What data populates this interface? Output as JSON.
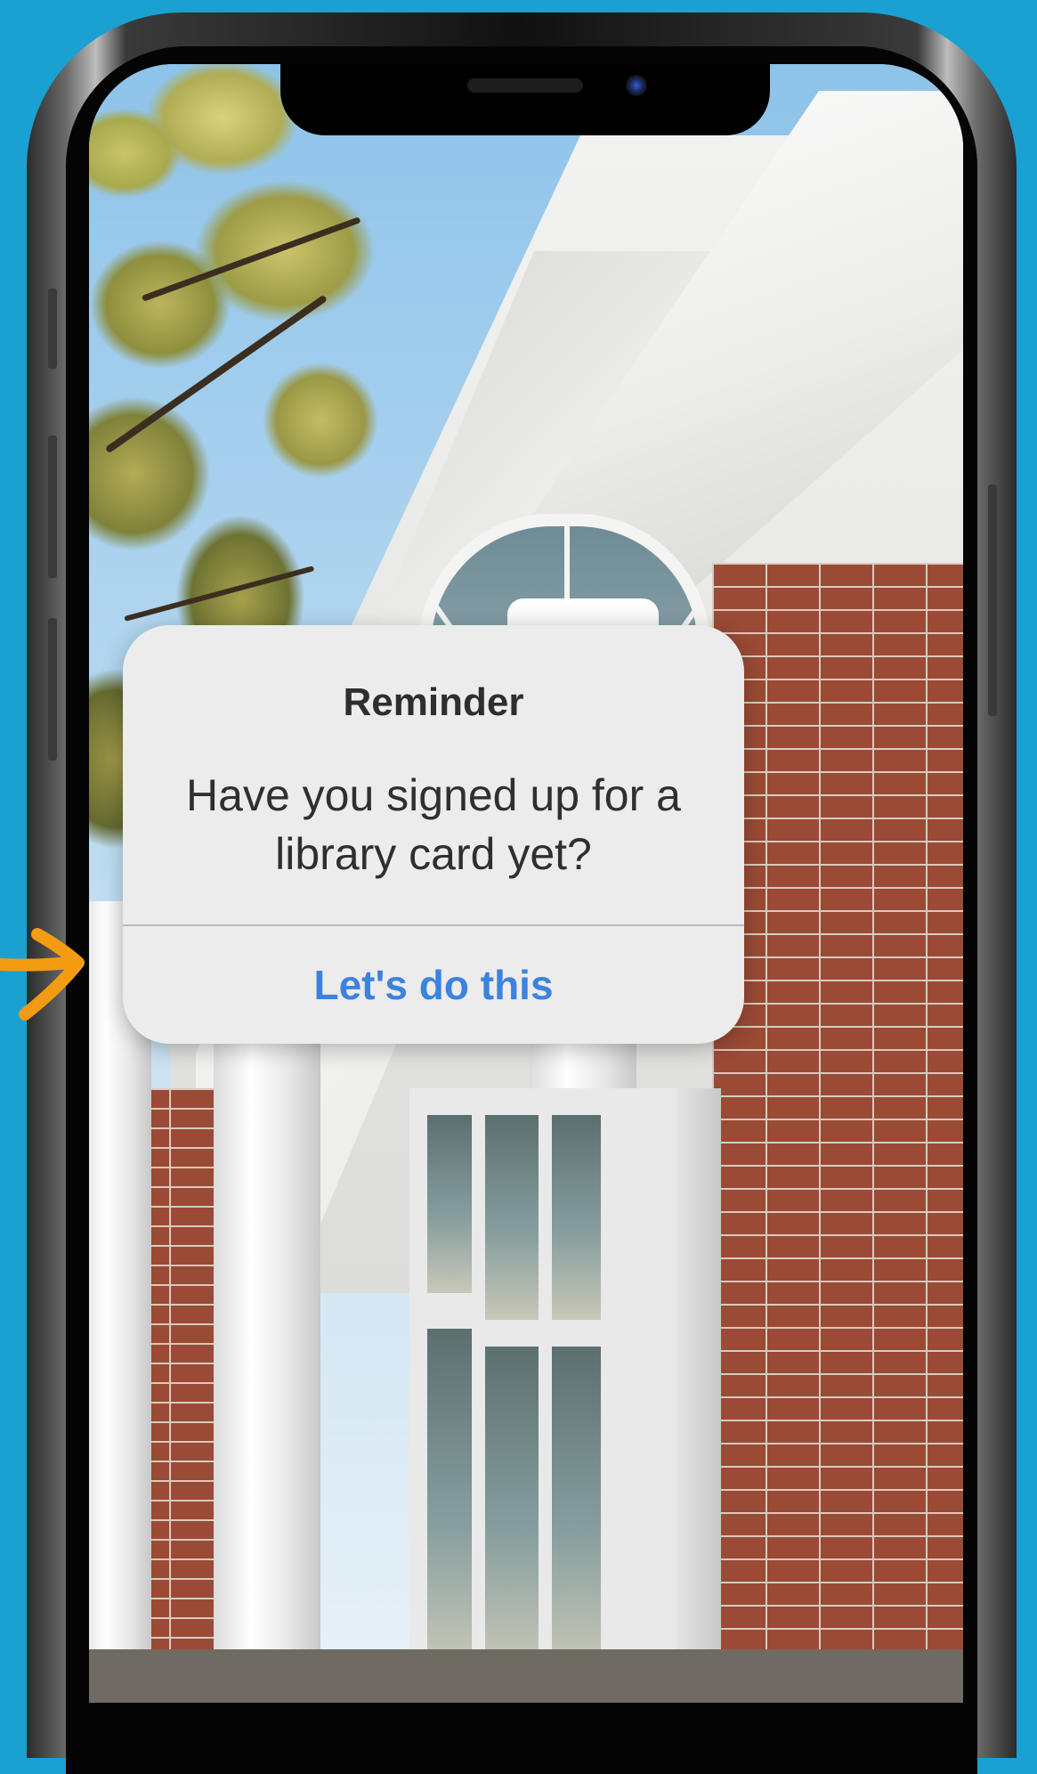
{
  "colors": {
    "background": "#1aa1d2",
    "alert_bg": "#ececec",
    "action_blue": "#3b83df",
    "arrow_orange": "#f39c12"
  },
  "alert": {
    "title": "Reminder",
    "message": "Have you signed up for a library card yet?",
    "action_label": "Let's do this"
  },
  "icons": {
    "pointer": "arrow-right-icon",
    "camera": "front-camera-icon"
  }
}
